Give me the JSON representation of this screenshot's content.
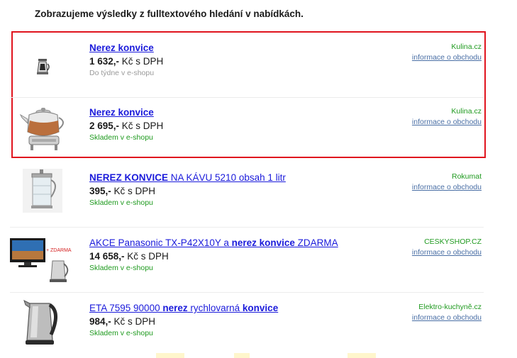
{
  "heading": "Zobrazujeme výsledky z fulltextového hledání v nabídkách.",
  "items": [
    {
      "title_parts": [
        {
          "text": "Nerez konvice",
          "bold": true
        }
      ],
      "price_bold": "1 632,-",
      "price_rest": " Kč s DPH",
      "availability": "Do týdne v e-shopu",
      "availability_color": "#9a9a9a",
      "shop": "Kulina.cz",
      "info_link": "informace o obchodu",
      "image": "small-kettle-image"
    },
    {
      "title_parts": [
        {
          "text": "Nerez konvice",
          "bold": true
        }
      ],
      "price_bold": "2 695,-",
      "price_rest": " Kč s DPH",
      "availability": "Skladem v e-shopu",
      "availability_color": "#1f9a1f",
      "shop": "Kulina.cz",
      "info_link": "informace o obchodu",
      "image": "teapot-warmer-image"
    },
    {
      "title_parts": [
        {
          "text": "NEREZ KONVICE",
          "bold": true
        },
        {
          "text": " NA KÁVU 5210 obsah 1 litr",
          "bold": false
        }
      ],
      "price_bold": "395,-",
      "price_rest": " Kč s DPH",
      "availability": "Skladem v e-shopu",
      "availability_color": "#1f9a1f",
      "shop": "Rokumat",
      "info_link": "informace o obchodu",
      "image": "french-press-image"
    },
    {
      "title_parts": [
        {
          "text": "AKCE Panasonic TX-P42X10Y a ",
          "bold": false
        },
        {
          "text": "nerez konvice",
          "bold": true
        },
        {
          "text": " ZDARMA",
          "bold": false
        }
      ],
      "price_bold": "14 658,-",
      "price_rest": " Kč s DPH",
      "availability": "Skladem v e-shopu",
      "availability_color": "#1f9a1f",
      "shop": "CESKYSHOP.CZ",
      "info_link": "informace o obchodu",
      "image": "tv-and-kettle-image",
      "image_badge": "+ ZDARMA"
    },
    {
      "title_parts": [
        {
          "text": "ETA 7595 90000 ",
          "bold": false
        },
        {
          "text": "nerez",
          "bold": true
        },
        {
          "text": " rychlovarná ",
          "bold": false
        },
        {
          "text": "konvice",
          "bold": true
        }
      ],
      "price_bold": "984,-",
      "price_rest": " Kč s DPH",
      "availability": "Skladem v e-shopu",
      "availability_color": "#1f9a1f",
      "shop": "Elektro-kuchyně.cz",
      "info_link": "informace o obchodu",
      "image": "electric-kettle-image"
    }
  ]
}
